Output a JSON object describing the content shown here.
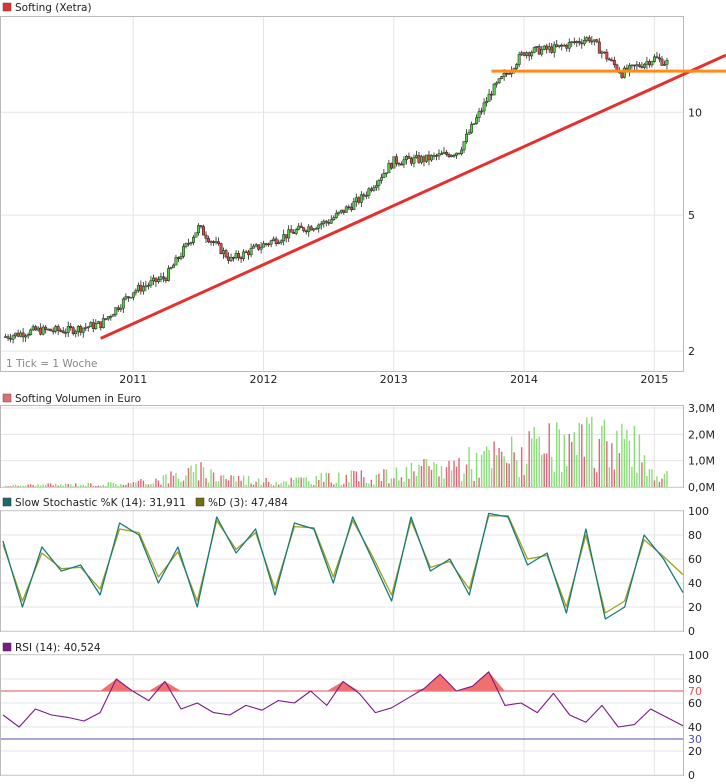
{
  "chart_data": [
    {
      "type": "candlestick",
      "title": "Softing (Xetra)",
      "note": "1 Tick = 1 Woche",
      "y_scale": "log",
      "ylim": [
        1.75,
        19
      ],
      "y_ticks": [
        "2",
        "5",
        "10"
      ],
      "x_ticks": [
        "2011",
        "2012",
        "2013",
        "2014",
        "2015"
      ],
      "series": [
        {
          "name": "Softing (Xetra)",
          "x": [
            "2010-01",
            "2010-04",
            "2010-07",
            "2010-10",
            "2011-01",
            "2011-04",
            "2011-07",
            "2011-10",
            "2012-01",
            "2012-04",
            "2012-07",
            "2012-10",
            "2013-01",
            "2013-04",
            "2013-07",
            "2013-10",
            "2014-01",
            "2014-04",
            "2014-07",
            "2014-10",
            "2015-01",
            "2015-02"
          ],
          "values": [
            2.2,
            2.3,
            2.3,
            2.4,
            3.0,
            3.3,
            4.6,
            3.7,
            4.1,
            4.5,
            4.8,
            5.6,
            7.2,
            7.3,
            7.7,
            11.5,
            15.0,
            15.4,
            16.5,
            13.0,
            14.4,
            14.0
          ]
        }
      ],
      "trendlines": [
        {
          "name": "support",
          "color": "#e53030",
          "x": [
            "2010-10",
            "2015-12"
          ],
          "values": [
            2.18,
            14.7
          ]
        },
        {
          "name": "horizontal",
          "color": "#ff8c1a",
          "x": [
            "2013-10",
            "2015-12"
          ],
          "values": [
            13.2,
            13.2
          ]
        }
      ]
    },
    {
      "type": "bar",
      "title": "Softing Volumen in Euro",
      "ylim": [
        0,
        3000000
      ],
      "y_ticks": [
        "0,0M",
        "1,0M",
        "2,0M",
        "3,0M"
      ],
      "x": [
        "2010",
        "2011",
        "2011-07",
        "2012",
        "2012-07",
        "2013",
        "2013-07",
        "2014",
        "2014-07",
        "2014-10",
        "2015"
      ],
      "values": [
        80000,
        200000,
        850000,
        300000,
        500000,
        650000,
        1300000,
        1950000,
        2350000,
        2950000,
        800000
      ],
      "up_color": "#88dd77",
      "down_color": "#dd6677"
    },
    {
      "type": "line",
      "title": "Slow Stochastic %K (14): 31,911",
      "title2": "%D (3): 47,484",
      "ylim": [
        0,
        100
      ],
      "y_ticks": [
        "0",
        "20",
        "40",
        "60",
        "80",
        "100"
      ],
      "series": [
        {
          "name": "Slow Stochastic %K (14): 31,911",
          "color": "#1a7a7a",
          "values": [
            75,
            20,
            70,
            50,
            55,
            30,
            90,
            80,
            40,
            70,
            20,
            95,
            65,
            85,
            30,
            90,
            85,
            40,
            95,
            60,
            25,
            95,
            50,
            60,
            30,
            98,
            95,
            55,
            65,
            15,
            85,
            10,
            20,
            80,
            60,
            32
          ]
        },
        {
          "name": "%D (3): 47,484",
          "color": "#a0a020",
          "values": [
            72,
            25,
            65,
            52,
            53,
            35,
            85,
            82,
            45,
            66,
            25,
            92,
            68,
            82,
            35,
            87,
            86,
            45,
            92,
            63,
            30,
            92,
            53,
            58,
            35,
            96,
            96,
            60,
            63,
            20,
            80,
            15,
            25,
            76,
            62,
            47
          ]
        }
      ],
      "ref_lines": [
        20,
        80
      ]
    },
    {
      "type": "area",
      "title": "RSI (14): 40,524",
      "ylim": [
        0,
        100
      ],
      "y_ticks": [
        "0",
        "20",
        "30",
        "40",
        "60",
        "70",
        "80",
        "100"
      ],
      "series": [
        {
          "name": "RSI (14): 40,524",
          "color": "#7a1a8a",
          "values": [
            50,
            40,
            55,
            50,
            48,
            45,
            52,
            80,
            70,
            62,
            78,
            55,
            60,
            52,
            50,
            58,
            54,
            62,
            60,
            70,
            58,
            78,
            68,
            52,
            56,
            64,
            72,
            84,
            70,
            74,
            86,
            58,
            60,
            52,
            68,
            50,
            44,
            58,
            40,
            42,
            55,
            48,
            41
          ]
        }
      ],
      "ref_lines": [
        {
          "value": 70,
          "color": "#e05050"
        },
        {
          "value": 30,
          "color": "#5050b0"
        }
      ]
    }
  ]
}
